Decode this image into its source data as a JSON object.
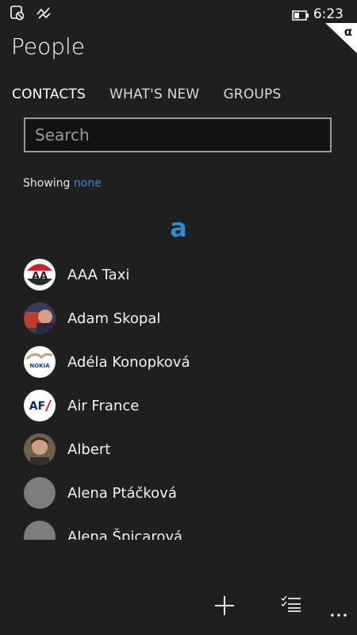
{
  "status_bar": {
    "time": "6:23",
    "icons": [
      "data-saver-icon",
      "signal-off-icon",
      "battery-icon"
    ]
  },
  "corner_badge": "α",
  "app": {
    "title": "People"
  },
  "tabs": [
    {
      "label": "CONTACTS",
      "active": true
    },
    {
      "label": "WHAT'S NEW",
      "active": false
    },
    {
      "label": "GROUPS",
      "active": false
    }
  ],
  "search": {
    "placeholder": "Search",
    "value": ""
  },
  "filter": {
    "prefix": "Showing",
    "value": "none"
  },
  "section_letter": "a",
  "contacts": [
    {
      "name": "AAA Taxi",
      "avatar": "aaa-taxi-logo"
    },
    {
      "name": "Adam Skopal",
      "avatar": "photo"
    },
    {
      "name": "Adéla Konopková",
      "avatar": "nokia-logo"
    },
    {
      "name": "Air France",
      "avatar": "air-france-logo"
    },
    {
      "name": "Albert",
      "avatar": "photo"
    },
    {
      "name": "Alena Ptáčková",
      "avatar": "placeholder"
    },
    {
      "name": "Alena Špicarová",
      "avatar": "placeholder"
    }
  ],
  "app_bar": {
    "buttons": [
      "add-icon",
      "select-icon",
      "more-icon"
    ]
  },
  "colors": {
    "accent": "#2a8fd6",
    "background": "#1f1f1f"
  }
}
